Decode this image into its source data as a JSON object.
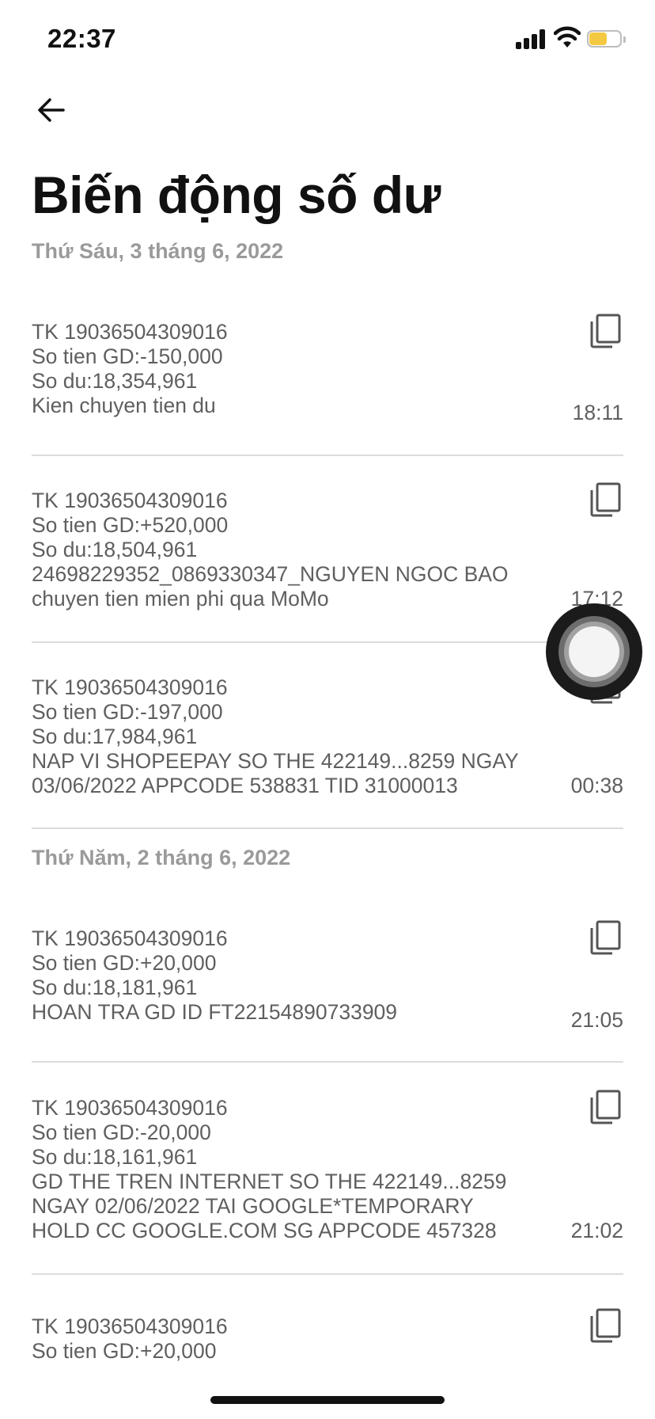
{
  "status_bar": {
    "time": "22:37",
    "battery_color": "#f4c942"
  },
  "header": {
    "back_icon": "arrow-left-icon",
    "title": "Biến động số dư"
  },
  "groups": [
    {
      "date": "Thứ Sáu, 3 tháng 6, 2022",
      "transactions": [
        {
          "lines": [
            "TK 19036504309016",
            "So tien GD:-150,000",
            "So du:18,354,961",
            "Kien chuyen tien du"
          ],
          "time": "18:11"
        },
        {
          "lines": [
            "TK 19036504309016",
            "So tien GD:+520,000",
            "So du:18,504,961",
            "24698229352_0869330347_NGUYEN NGOC BAO",
            "chuyen tien mien phi qua MoMo"
          ],
          "time": "17:12"
        },
        {
          "lines": [
            "TK 19036504309016",
            "So tien GD:-197,000",
            "So du:17,984,961",
            "NAP VI SHOPEEPAY SO THE 422149...8259 NGAY",
            "03/06/2022 APPCODE 538831 TID 31000013"
          ],
          "time": "00:38"
        }
      ]
    },
    {
      "date": "Thứ Năm, 2 tháng 6, 2022",
      "transactions": [
        {
          "lines": [
            "TK 19036504309016",
            "So tien GD:+20,000",
            "So du:18,181,961",
            "HOAN TRA GD ID FT22154890733909"
          ],
          "time": "21:05"
        },
        {
          "lines": [
            "TK 19036504309016",
            "So tien GD:-20,000",
            "So du:18,161,961",
            "GD THE TREN INTERNET SO THE 422149...8259",
            "NGAY 02/06/2022 TAI GOOGLE*TEMPORARY",
            "HOLD CC GOOGLE.COM SG APPCODE 457328"
          ],
          "time": "21:02"
        },
        {
          "lines": [
            "TK 19036504309016",
            "So tien GD:+20,000"
          ],
          "time": ""
        }
      ]
    }
  ],
  "icons": {
    "copy": "copy-icon",
    "assistive_touch": "assistive-touch-icon"
  }
}
